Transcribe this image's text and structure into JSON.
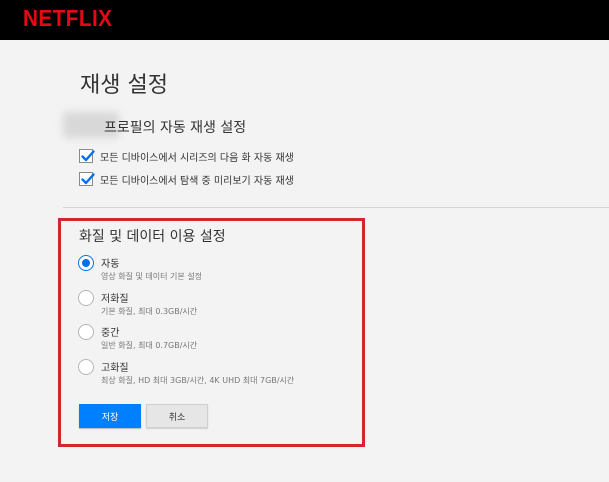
{
  "header": {
    "logo": "NETFLIX"
  },
  "page": {
    "title": "재생 설정"
  },
  "autoplay": {
    "heading": "프로필의 자동 재생 설정",
    "options": [
      {
        "label": "모든 디바이스에서 시리즈의 다음 화 자동 재생",
        "checked": true
      },
      {
        "label": "모든 디바이스에서 탐색 중 미리보기 자동 재생",
        "checked": true
      }
    ]
  },
  "quality": {
    "title": "화질 및 데이터 이용 설정",
    "options": [
      {
        "label": "자동",
        "desc": "영상 화질 및 데이터 기본 설정",
        "selected": true
      },
      {
        "label": "저화질",
        "desc": "기본 화질, 최대 0.3GB/시간",
        "selected": false
      },
      {
        "label": "중간",
        "desc": "일반 화질, 최대 0.7GB/시간",
        "selected": false
      },
      {
        "label": "고화질",
        "desc": "최상 화질, HD 최대 3GB/시간, 4K UHD 최대 7GB/시간",
        "selected": false
      }
    ]
  },
  "buttons": {
    "save": "저장",
    "cancel": "취소"
  },
  "colors": {
    "brand": "#e50914",
    "accent": "#0080ff",
    "highlight": "#d0272d"
  }
}
